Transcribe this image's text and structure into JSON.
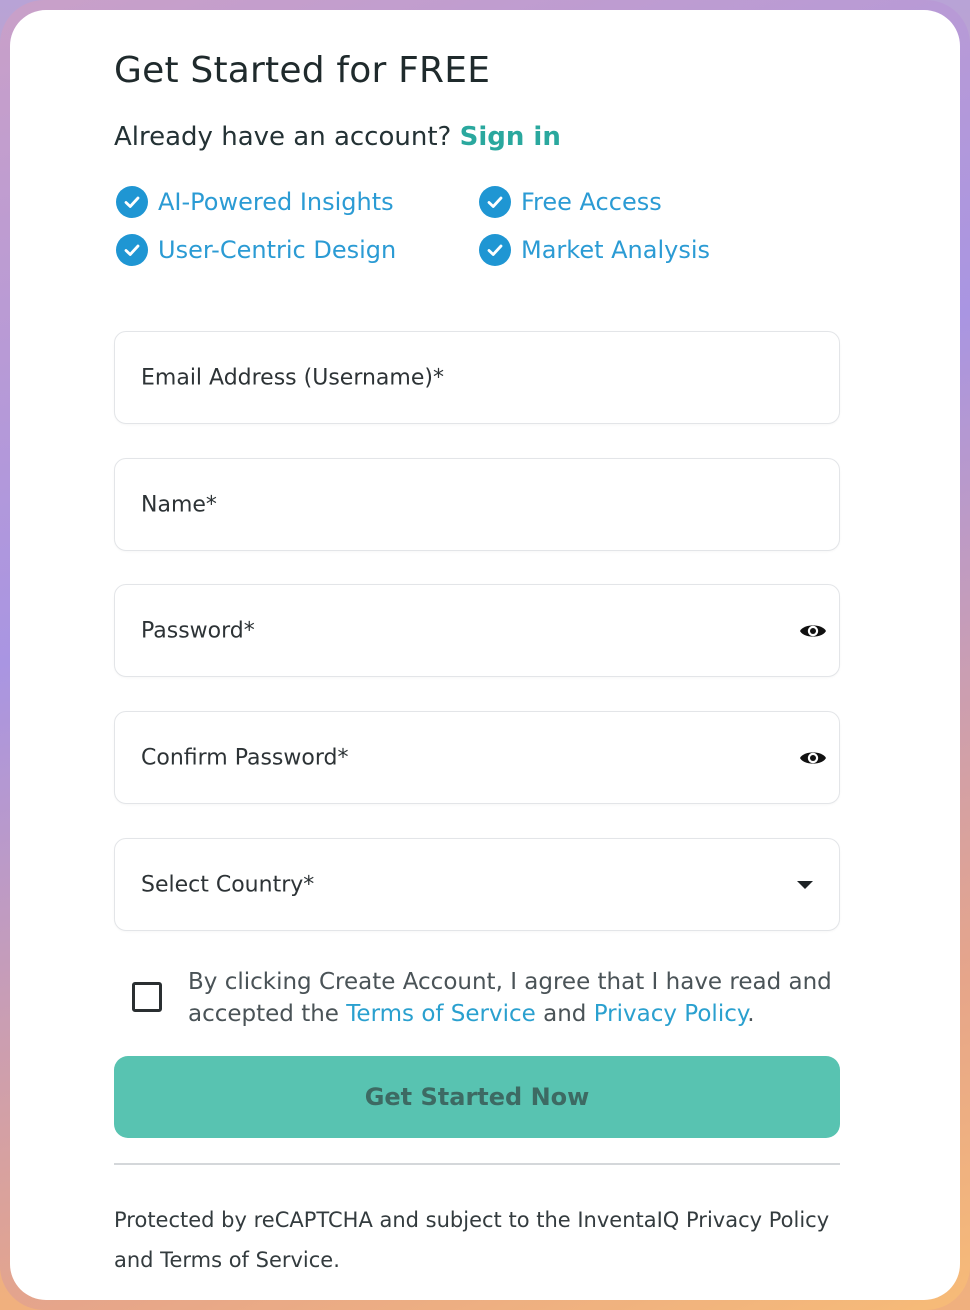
{
  "header": {
    "title": "Get Started for FREE",
    "signin_prompt": "Already have an account?",
    "signin_link": "Sign in"
  },
  "features": [
    {
      "label": "AI-Powered Insights",
      "icon": "check-circle-icon"
    },
    {
      "label": "Free Access",
      "icon": "check-circle-icon"
    },
    {
      "label": "User-Centric Design",
      "icon": "check-circle-icon"
    },
    {
      "label": "Market Analysis",
      "icon": "check-circle-icon"
    }
  ],
  "form": {
    "email": {
      "placeholder": "Email Address (Username)*",
      "value": ""
    },
    "name": {
      "placeholder": "Name*",
      "value": ""
    },
    "password": {
      "placeholder": "Password*",
      "value": "",
      "icon": "eye-icon"
    },
    "confirm_password": {
      "placeholder": "Confirm Password*",
      "value": "",
      "icon": "eye-icon"
    },
    "country": {
      "placeholder": "Select Country*",
      "selected": "",
      "icon": "caret-down-icon"
    },
    "agreement": {
      "checked": false,
      "text_before": "By clicking Create Account, I agree that I have read and accepted the",
      "terms_link": "Terms of Service",
      "text_and": "and",
      "privacy_link": "Privacy Policy",
      "text_end": "."
    },
    "submit_label": "Get Started Now"
  },
  "footer": {
    "text": "Protected by reCAPTCHA and subject to the InventaIQ Privacy Policy and Terms of Service."
  },
  "colors": {
    "accent": "#2aa89e",
    "feature_blue": "#1f96d3",
    "button": "#58c3b1",
    "link_blue": "#2aa0cf"
  }
}
